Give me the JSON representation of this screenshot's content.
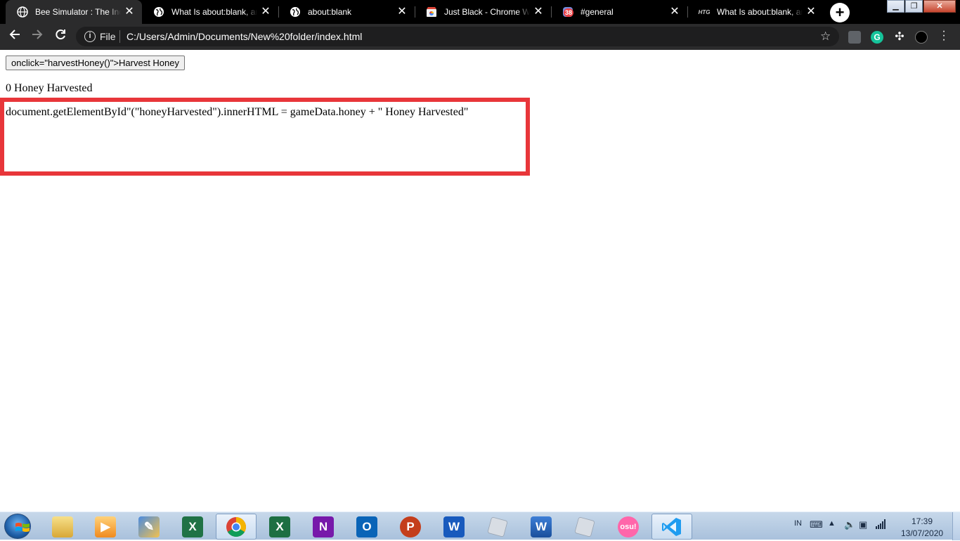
{
  "browser": {
    "tabs": [
      {
        "title": "Bee Simulator : The Incremental Game",
        "active": true,
        "icon": "globe-icon"
      },
      {
        "title": "What Is about:blank, and Why",
        "active": false,
        "icon": "globe-icon"
      },
      {
        "title": "about:blank",
        "active": false,
        "icon": "globe-icon"
      },
      {
        "title": "Just Black - Chrome Web Store",
        "active": false,
        "icon": "store-icon"
      },
      {
        "title": "#general",
        "active": false,
        "icon": "discord-icon",
        "badge": "38"
      },
      {
        "title": "What Is about:blank, and Why",
        "active": false,
        "icon": "htg-icon",
        "icon_text": "HTG"
      }
    ],
    "new_tab_label": "+",
    "omnibox": {
      "scheme_label": "File",
      "url": "C:/Users/Admin/Documents/New%20folder/index.html"
    }
  },
  "page": {
    "button_label": "onclick=\"harvestHoney()\">Harvest Honey",
    "honey_text": "0 Honey Harvested",
    "code_text": "document.getElementById\"(\"honeyHarvested\").innerHTML = gameData.honey + \" Honey Harvested\"",
    "highlight_color": "#e8363a"
  },
  "taskbar": {
    "apps": [
      {
        "name": "file-explorer",
        "label": ""
      },
      {
        "name": "media-player",
        "label": ""
      },
      {
        "name": "paint-tool",
        "label": ""
      },
      {
        "name": "excel-legacy",
        "label": "X"
      },
      {
        "name": "chrome",
        "label": "",
        "active": true
      },
      {
        "name": "excel",
        "label": "X"
      },
      {
        "name": "onenote",
        "label": "N"
      },
      {
        "name": "outlook",
        "label": "O"
      },
      {
        "name": "powerpoint",
        "label": "P"
      },
      {
        "name": "word",
        "label": "W"
      },
      {
        "name": "roblox-studio",
        "label": ""
      },
      {
        "name": "word-legacy",
        "label": "W"
      },
      {
        "name": "roblox",
        "label": ""
      },
      {
        "name": "osu",
        "label": "osu!"
      },
      {
        "name": "vscode",
        "label": "",
        "active": true
      }
    ],
    "language": "IN",
    "clock_time": "17:39",
    "clock_date": "13/07/2020"
  }
}
